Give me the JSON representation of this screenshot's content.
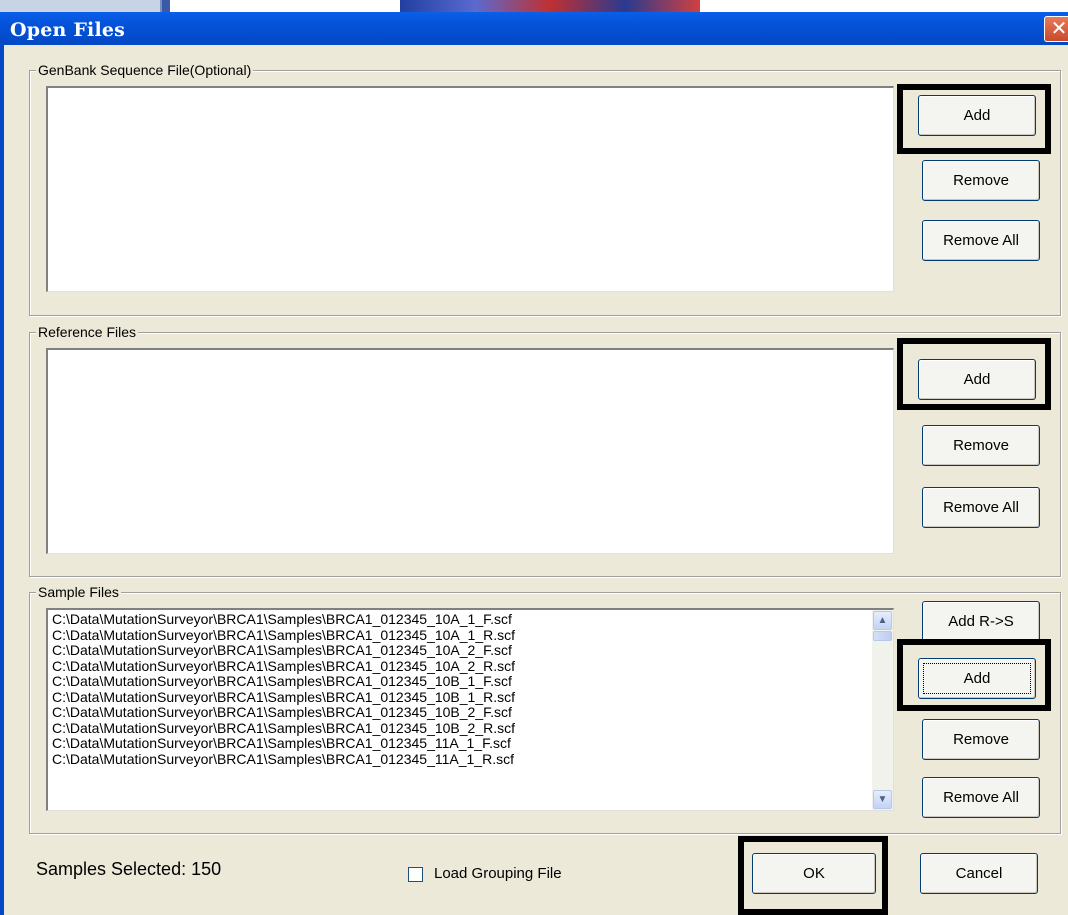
{
  "dialog": {
    "title": "Open Files",
    "close_glyph": "✕"
  },
  "genbank": {
    "label": "GenBank Sequence File(Optional)",
    "buttons": {
      "add": "Add",
      "remove": "Remove",
      "remove_all": "Remove All"
    }
  },
  "reference": {
    "label": "Reference Files",
    "buttons": {
      "add": "Add",
      "remove": "Remove",
      "remove_all": "Remove All"
    }
  },
  "samples": {
    "label": "Sample Files",
    "files": [
      "C:\\Data\\MutationSurveyor\\BRCA1\\Samples\\BRCA1_012345_10A_1_F.scf",
      "C:\\Data\\MutationSurveyor\\BRCA1\\Samples\\BRCA1_012345_10A_1_R.scf",
      "C:\\Data\\MutationSurveyor\\BRCA1\\Samples\\BRCA1_012345_10A_2_F.scf",
      "C:\\Data\\MutationSurveyor\\BRCA1\\Samples\\BRCA1_012345_10A_2_R.scf",
      "C:\\Data\\MutationSurveyor\\BRCA1\\Samples\\BRCA1_012345_10B_1_F.scf",
      "C:\\Data\\MutationSurveyor\\BRCA1\\Samples\\BRCA1_012345_10B_1_R.scf",
      "C:\\Data\\MutationSurveyor\\BRCA1\\Samples\\BRCA1_012345_10B_2_F.scf",
      "C:\\Data\\MutationSurveyor\\BRCA1\\Samples\\BRCA1_012345_10B_2_R.scf",
      "C:\\Data\\MutationSurveyor\\BRCA1\\Samples\\BRCA1_012345_11A_1_F.scf",
      "C:\\Data\\MutationSurveyor\\BRCA1\\Samples\\BRCA1_012345_11A_1_R.scf"
    ],
    "buttons": {
      "add_r_s": "Add R->S",
      "add": "Add",
      "remove": "Remove",
      "remove_all": "Remove All"
    }
  },
  "footer": {
    "samples_selected": "Samples Selected: 150",
    "load_grouping_label": "Load Grouping File",
    "load_grouping_checked": false,
    "ok": "OK",
    "cancel": "Cancel"
  },
  "colors": {
    "titlebar": "#0452d8",
    "dialog_bg": "#ECE9D8",
    "highlight": "#000000"
  },
  "icons": {
    "close": "close-icon",
    "scroll_up": "scroll-up-icon",
    "scroll_down": "scroll-down-icon"
  }
}
